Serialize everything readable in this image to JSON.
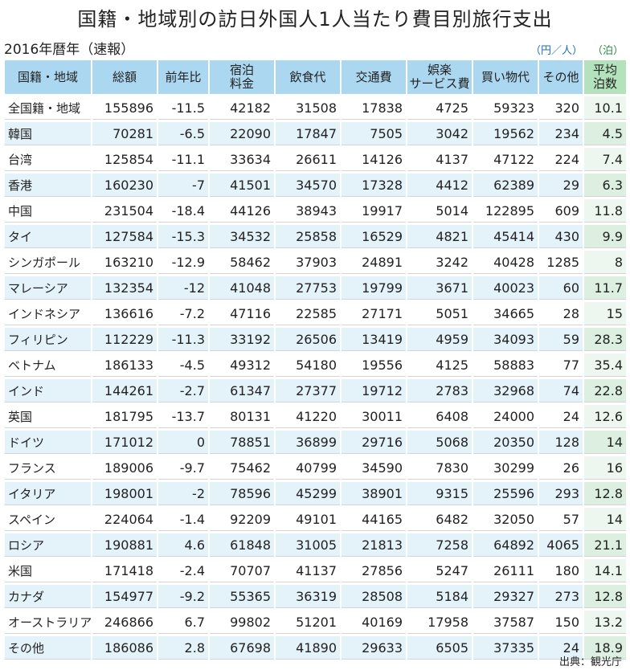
{
  "title": "国籍・地域別の訪日外国人1人当たり費目別旅行支出",
  "subtitle": "2016年暦年（速報）",
  "unit_yen": "（円／人）",
  "unit_nights": "（泊）",
  "headers": [
    "国籍・地域",
    "総額",
    "前年比",
    "宿泊\n料金",
    "飲食代",
    "交通費",
    "娯楽\nサービス費",
    "買い物代",
    "その他",
    "平均\n泊数"
  ],
  "rows": [
    [
      "全国籍・地域",
      "155896",
      "-11.5",
      "42182",
      "31508",
      "17838",
      "4725",
      "59323",
      "320",
      "10.1"
    ],
    [
      "韓国",
      "70281",
      "-6.5",
      "22090",
      "17847",
      "7505",
      "3042",
      "19562",
      "234",
      "4.5"
    ],
    [
      "台湾",
      "125854",
      "-11.1",
      "33634",
      "26611",
      "14126",
      "4137",
      "47122",
      "224",
      "7.4"
    ],
    [
      "香港",
      "160230",
      "-7",
      "41501",
      "34570",
      "17328",
      "4412",
      "62389",
      "29",
      "6.3"
    ],
    [
      "中国",
      "231504",
      "-18.4",
      "44126",
      "38943",
      "19917",
      "5014",
      "122895",
      "609",
      "11.8"
    ],
    [
      "タイ",
      "127584",
      "-15.3",
      "34532",
      "25858",
      "16529",
      "4821",
      "45414",
      "430",
      "9.9"
    ],
    [
      "シンガポール",
      "163210",
      "-12.9",
      "58462",
      "37903",
      "24891",
      "3242",
      "40428",
      "1285",
      "8"
    ],
    [
      "マレーシア",
      "132354",
      "-12",
      "41048",
      "27753",
      "19799",
      "3671",
      "40023",
      "60",
      "11.7"
    ],
    [
      "インドネシア",
      "136616",
      "-7.2",
      "47116",
      "22585",
      "27171",
      "5051",
      "34665",
      "28",
      "15"
    ],
    [
      "フィリピン",
      "112229",
      "-11.3",
      "33192",
      "26506",
      "13419",
      "4959",
      "34093",
      "59",
      "28.3"
    ],
    [
      "ベトナム",
      "186133",
      "-4.5",
      "49312",
      "54180",
      "19556",
      "4125",
      "58883",
      "77",
      "35.4"
    ],
    [
      "インド",
      "144261",
      "-2.7",
      "61347",
      "27377",
      "19712",
      "2783",
      "32968",
      "74",
      "22.8"
    ],
    [
      "英国",
      "181795",
      "-13.7",
      "80131",
      "41220",
      "30011",
      "6408",
      "24000",
      "24",
      "12.6"
    ],
    [
      "ドイツ",
      "171012",
      "0",
      "78851",
      "36899",
      "29716",
      "5068",
      "20350",
      "128",
      "14"
    ],
    [
      "フランス",
      "189006",
      "-9.7",
      "75462",
      "40799",
      "34590",
      "7830",
      "30299",
      "26",
      "16"
    ],
    [
      "イタリア",
      "198001",
      "-2",
      "78596",
      "45299",
      "38901",
      "9315",
      "25596",
      "293",
      "12.8"
    ],
    [
      "スペイン",
      "224064",
      "-1.4",
      "92209",
      "49101",
      "44165",
      "6482",
      "32050",
      "57",
      "14"
    ],
    [
      "ロシア",
      "190881",
      "4.6",
      "61848",
      "31005",
      "21813",
      "7258",
      "64892",
      "4065",
      "21.1"
    ],
    [
      "米国",
      "171418",
      "-2.4",
      "70707",
      "41137",
      "27856",
      "5247",
      "26111",
      "180",
      "14.1"
    ],
    [
      "カナダ",
      "154977",
      "-9.2",
      "55365",
      "36319",
      "28508",
      "5184",
      "29327",
      "273",
      "12.8"
    ],
    [
      "オーストラリア",
      "246866",
      "6.7",
      "99802",
      "51201",
      "40169",
      "17958",
      "37587",
      "150",
      "13.2"
    ],
    [
      "その他",
      "186086",
      "2.8",
      "67698",
      "41890",
      "29633",
      "6505",
      "37335",
      "24",
      "18.9"
    ]
  ],
  "source": "出典：観光庁"
}
